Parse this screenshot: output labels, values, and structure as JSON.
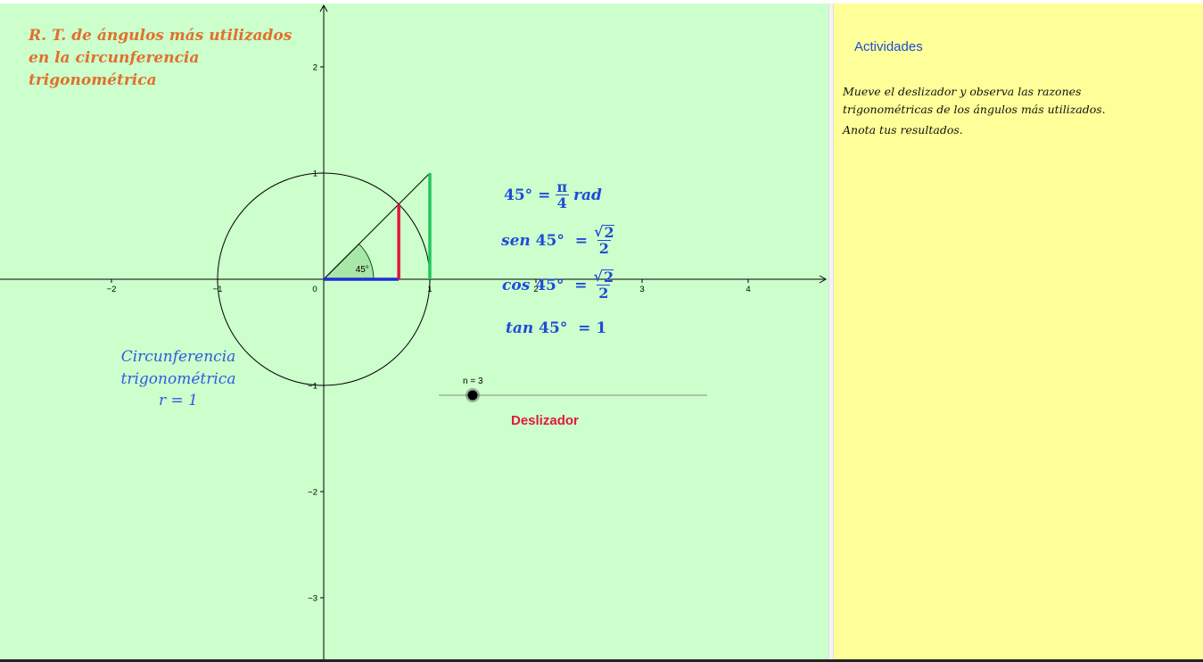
{
  "graphics": {
    "title_lines": [
      "R. T. de ángulos más utilizados",
      "en la circunferencia",
      "trigonométrica"
    ],
    "circle_label": [
      "Circunferencia",
      "trigonométrica",
      "r = 1"
    ],
    "axis": {
      "x_ticks": [
        "−2",
        "−1",
        "0",
        "1",
        "2",
        "3",
        "4"
      ],
      "y_ticks": [
        "2",
        "1",
        "−1",
        "−2",
        "−3"
      ],
      "x_range": [
        -3,
        4.7
      ],
      "y_range": [
        -3.6,
        2.6
      ]
    },
    "angle": {
      "degrees": 45,
      "label": "45°"
    },
    "formulas": {
      "deg_rad": {
        "lhs": "45° =",
        "num": "π",
        "den": "4",
        "suffix": "rad"
      },
      "sen": {
        "fn": "sen",
        "arg": "45°",
        "eq": "=",
        "num": "√2",
        "den": "2"
      },
      "cos": {
        "fn": "cos",
        "arg": "45°",
        "eq": "=",
        "num": "√2",
        "den": "2"
      },
      "tan": {
        "fn": "tan",
        "arg": "45°",
        "eq": "= 1"
      }
    },
    "slider": {
      "label": "n = 3",
      "value": 3,
      "caption": "Deslizador"
    },
    "colors": {
      "background": "#ccffcc",
      "title": "#e0702c",
      "formula": "#1f4bd8",
      "sine": "#e0193c",
      "cosine": "#1f2fd8",
      "tangent": "#22c55e"
    }
  },
  "side_panel": {
    "link": "Actividades",
    "instructions": [
      "Mueve el deslizador y observa las razones trigonométricas de los ángulos más utilizados.",
      "Anota tus resultados."
    ],
    "background": "#ffff99"
  }
}
